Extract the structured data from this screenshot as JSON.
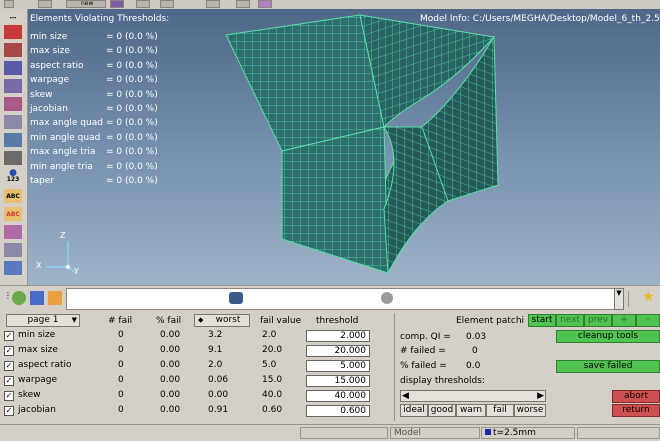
{
  "viewport": {
    "header": "Elements Violating Thresholds:",
    "model_info": "Model Info: C:/Users/MEGHA/Desktop/Model_6_th_2.5.h",
    "violations": [
      {
        "name": "min size",
        "value": "= 0 (0.0 %)"
      },
      {
        "name": "max size",
        "value": "= 0 (0.0 %)"
      },
      {
        "name": "aspect ratio",
        "value": "= 0 (0.0 %)"
      },
      {
        "name": "warpage",
        "value": "= 0 (0.0 %)"
      },
      {
        "name": "skew",
        "value": "= 0 (0.0 %)"
      },
      {
        "name": "jacobian",
        "value": "= 0 (0.0 %)"
      },
      {
        "name": "max angle quad",
        "value": "= 0 (0.0 %)"
      },
      {
        "name": "min angle quad",
        "value": "= 0 (0.0 %)"
      },
      {
        "name": "max angle tria",
        "value": "= 0 (0.0 %)"
      },
      {
        "name": "min angle tria",
        "value": "= 0 (0.0 %)"
      },
      {
        "name": "taper",
        "value": "= 0 (0.0 %)"
      }
    ],
    "axes": {
      "z": "Z",
      "x": "X",
      "y": "Y"
    },
    "mesh_color": "#2e6e6e",
    "mesh_line_color": "#59e0a6"
  },
  "top_toolbar": {
    "new_label": "new"
  },
  "left_tools": {
    "badge_123": "123",
    "abc_1": "ABC",
    "abc_2": "ABC"
  },
  "table": {
    "page_select": "page 1",
    "headers": {
      "fail": "# fail",
      "pfail": "% fail",
      "worst": "worst",
      "fail_value": "fail value",
      "threshold": "threshold"
    },
    "rows": [
      {
        "checked": "✓",
        "name": "min size",
        "fail": "0",
        "pfail": "0.00",
        "worst": "3.2",
        "fail_value": "2.0",
        "threshold": "2.000"
      },
      {
        "checked": "✓",
        "name": "max size",
        "fail": "0",
        "pfail": "0.00",
        "worst": "9.1",
        "fail_value": "20.0",
        "threshold": "20.000"
      },
      {
        "checked": "✓",
        "name": "aspect ratio",
        "fail": "0",
        "pfail": "0.00",
        "worst": "2.0",
        "fail_value": "5.0",
        "threshold": "5.000"
      },
      {
        "checked": "✓",
        "name": "warpage",
        "fail": "0",
        "pfail": "0.00",
        "worst": "0.06",
        "fail_value": "15.0",
        "threshold": "15.000"
      },
      {
        "checked": "✓",
        "name": "skew",
        "fail": "0",
        "pfail": "0.00",
        "worst": "0.00",
        "fail_value": "40.0",
        "threshold": "40.000"
      },
      {
        "checked": "✓",
        "name": "jacobian",
        "fail": "0",
        "pfail": "0.00",
        "worst": "0.91",
        "fail_value": "0.60",
        "threshold": "0.600"
      }
    ]
  },
  "qi_panel": {
    "element_patch_label": "Element patchi",
    "comp_qi_label": "comp. QI =",
    "comp_qi_value": "0.03",
    "failed_label": "# failed =",
    "failed_value": "0",
    "pfailed_label": "% failed =",
    "pfailed_value": "0.0",
    "display_thresholds_label": "display thresholds:",
    "threshold_buttons": [
      "ideal",
      "good",
      "warn",
      "fail",
      "worse"
    ]
  },
  "right_buttons": {
    "start": "start",
    "next": "next",
    "prev": "prev",
    "plus": "+",
    "minus": "-",
    "cleanup_tools": "cleanup tools",
    "save_failed": "save failed",
    "abort": "abort",
    "return": "return"
  },
  "status_bar": {
    "model": "Model",
    "thickness": "t=2.5mm"
  }
}
